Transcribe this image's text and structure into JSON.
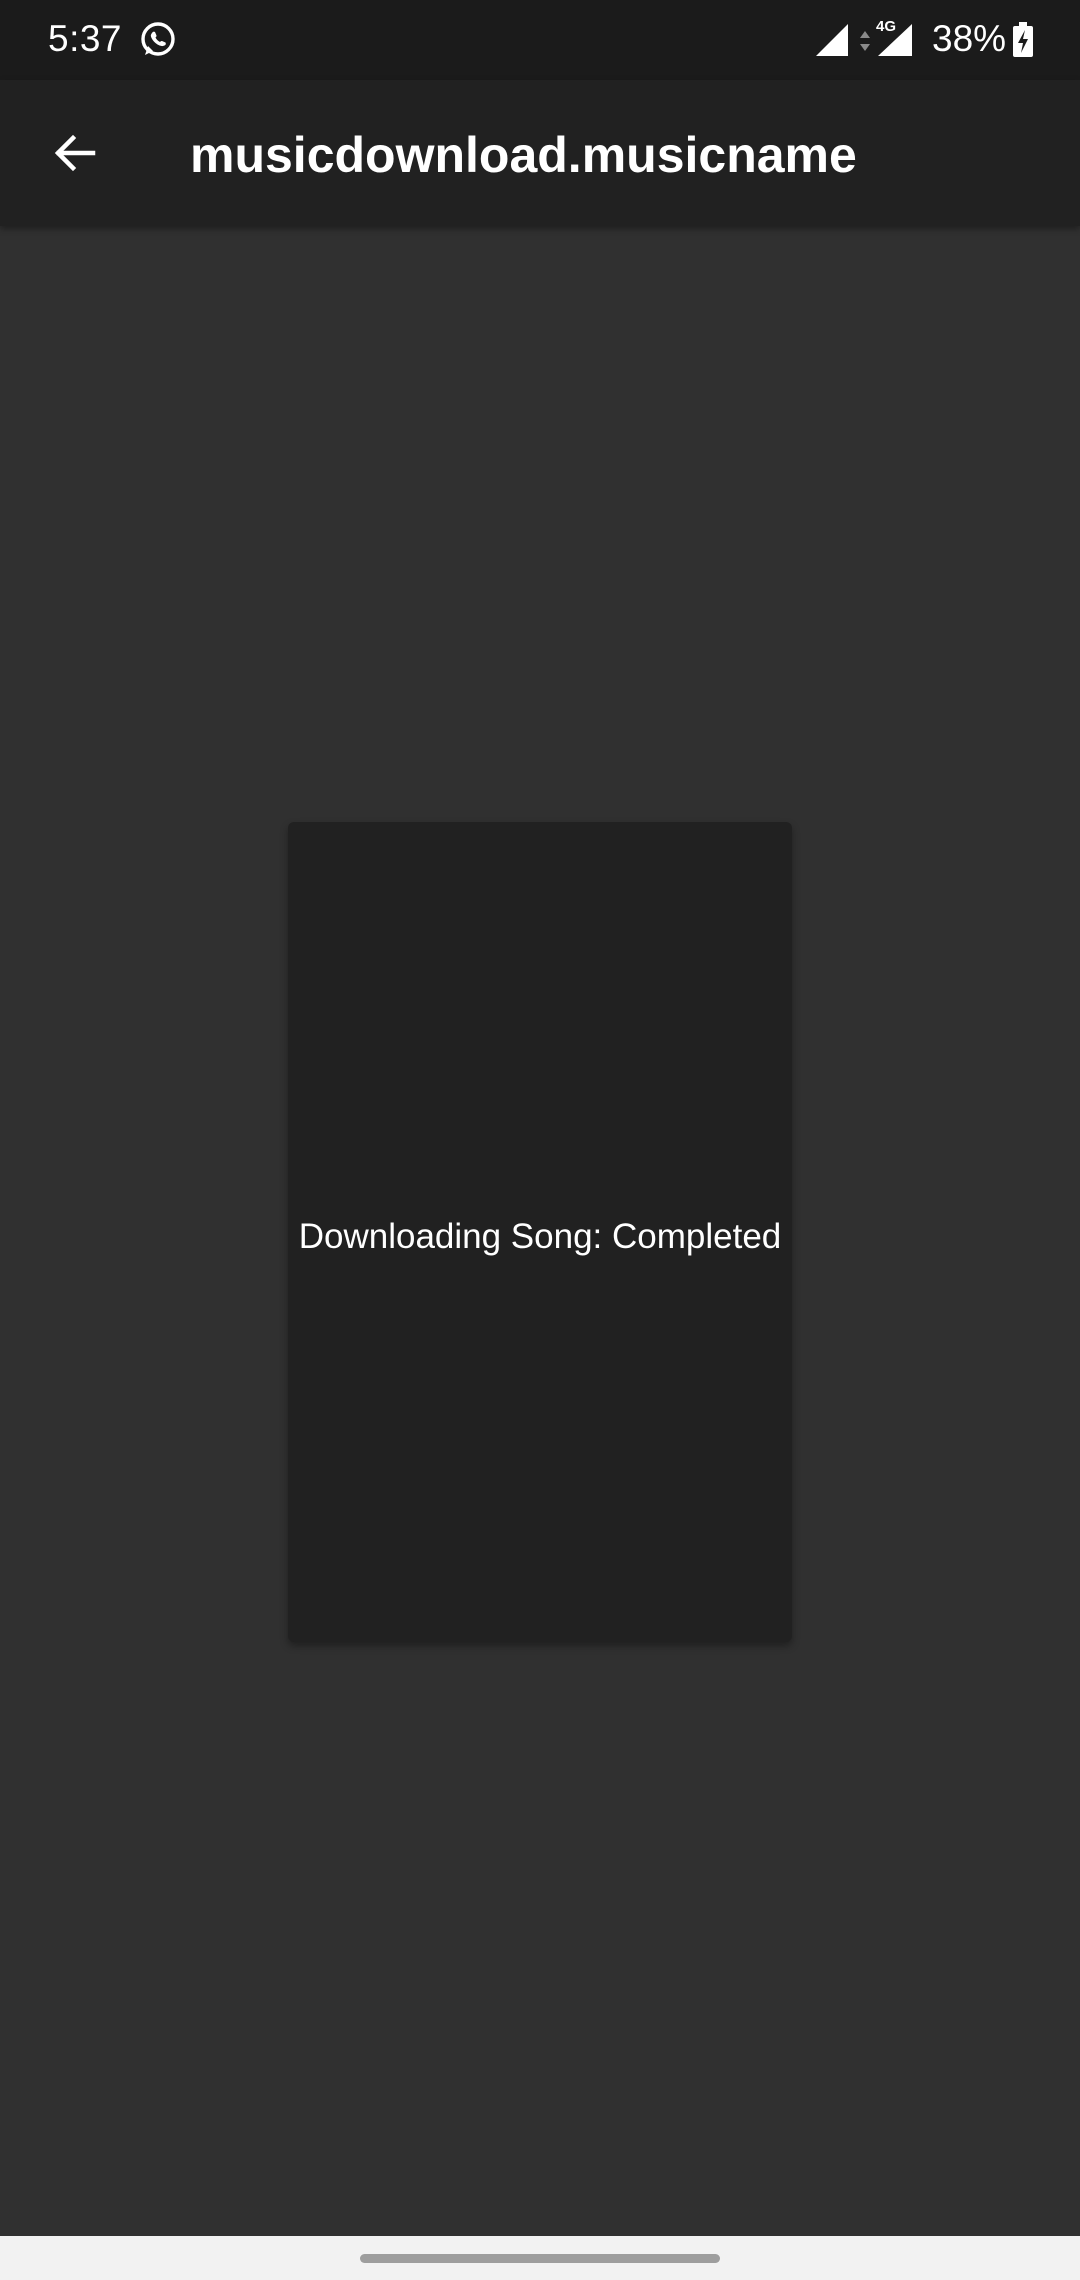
{
  "status_bar": {
    "time": "5:37",
    "notification_icon": "whatsapp-icon",
    "network_type": "4G",
    "battery_percent": "38%",
    "icons": [
      "signal-icon",
      "data-arrows-icon",
      "signal-icon",
      "battery-charging-icon"
    ]
  },
  "app_bar": {
    "back_icon": "arrow-back-icon",
    "title": "musicdownload.musicname"
  },
  "card": {
    "status_text": "Downloading Song: Completed"
  },
  "nav_bar": {
    "home_indicator_icon": "home-indicator"
  },
  "colors": {
    "background": "#303030",
    "status_bar": "#1b1b1b",
    "app_bar": "#212121",
    "card": "#212121",
    "text": "#ffffff",
    "nav_bar": "#f2f2f2",
    "home_indicator": "#9e9e9e"
  }
}
